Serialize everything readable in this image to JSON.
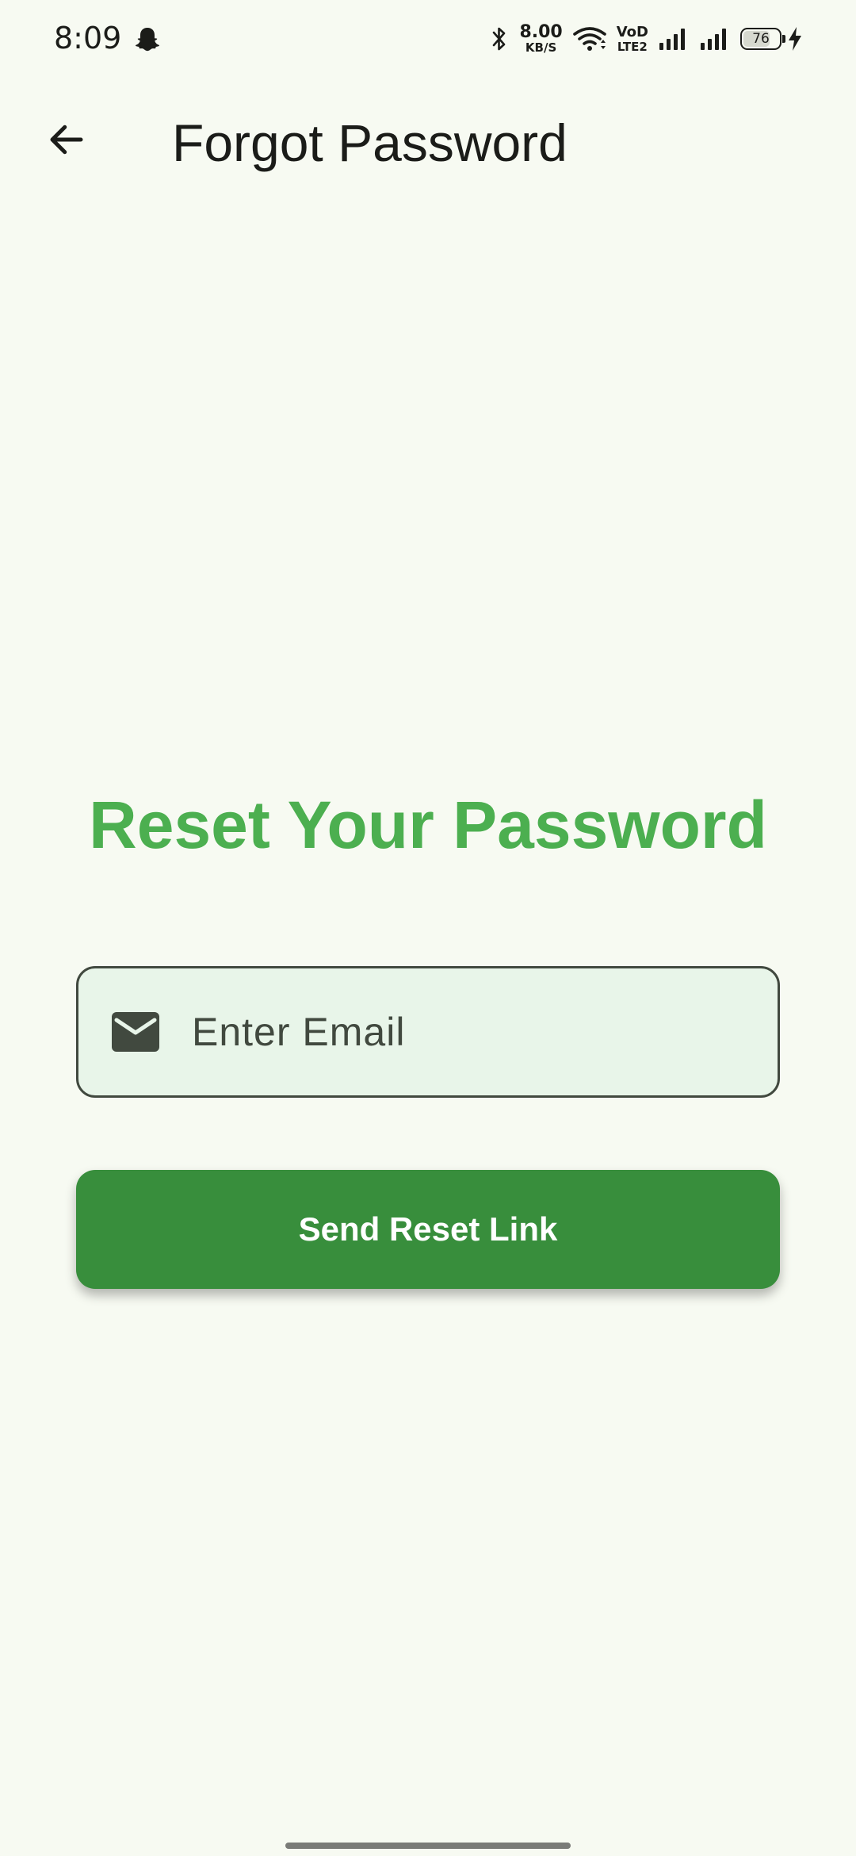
{
  "status_bar": {
    "time": "8:09",
    "net_speed_value": "8.00",
    "net_speed_unit": "KB/S",
    "volte_top": "VoD",
    "volte_bottom": "LTE2",
    "battery_level": "76",
    "battery_fraction": 0.76,
    "icons": [
      "snapchat-icon",
      "bluetooth-icon",
      "wifi-icon",
      "signal-icon",
      "signal-icon",
      "battery-icon",
      "charging-bolt-icon"
    ]
  },
  "app_bar": {
    "back_icon": "arrow-left-icon",
    "title": "Forgot Password"
  },
  "main": {
    "heading": "Reset Your Password",
    "email_field": {
      "icon": "mail-icon",
      "placeholder": "Enter Email",
      "value": ""
    },
    "send_button_label": "Send Reset Link"
  },
  "colors": {
    "background": "#f7faf2",
    "heading": "#4caf50",
    "button": "#388e3c",
    "field_fill": "#e8f5e9",
    "field_border": "#41493f",
    "on_button": "#ffffff"
  }
}
